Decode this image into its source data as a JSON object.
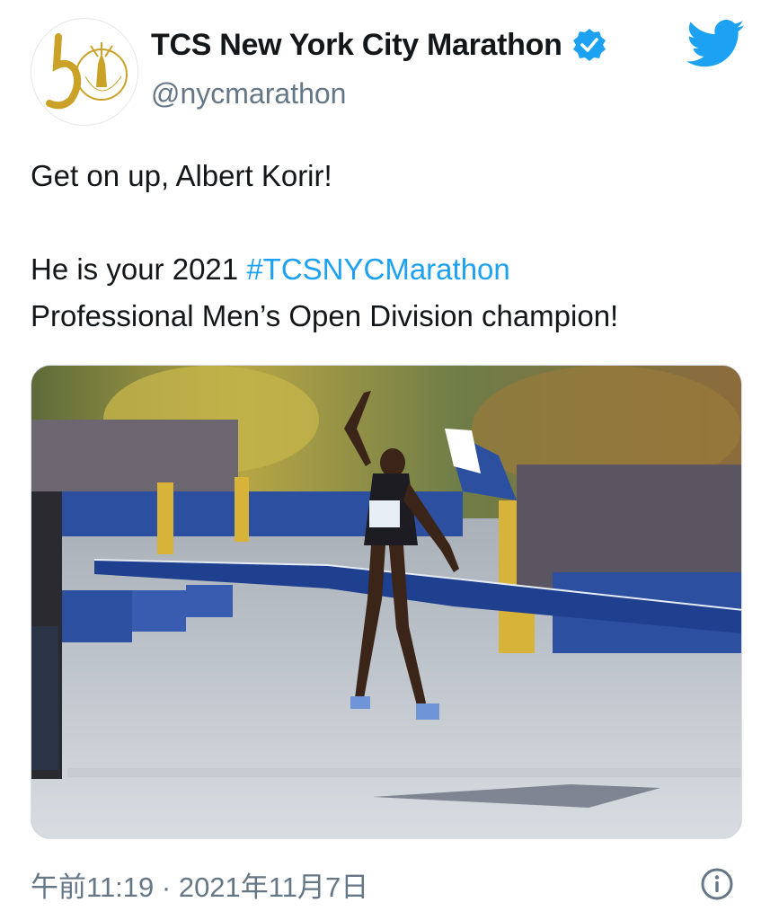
{
  "header": {
    "display_name": "TCS New York City Marathon",
    "handle": "@nycmarathon",
    "avatar_logo_text": "5 TCS NEW YORK CITY MARATHON"
  },
  "tweet": {
    "line1": "Get on up, Albert Korir!",
    "line2_prefix": "He is your 2021 ",
    "hashtag": "#TCSNYCMarathon",
    "line3": "Professional Men’s Open Division champion!"
  },
  "footer": {
    "timestamp": "午前11:19 · 2021年11月7日"
  },
  "colors": {
    "accent": "#1da1f2",
    "secondary_text": "#657786",
    "tape_blue": "#1f3f8f"
  },
  "icons": {
    "verified": "verified-badge-icon",
    "brand": "twitter-bird-icon",
    "info": "info-icon"
  }
}
